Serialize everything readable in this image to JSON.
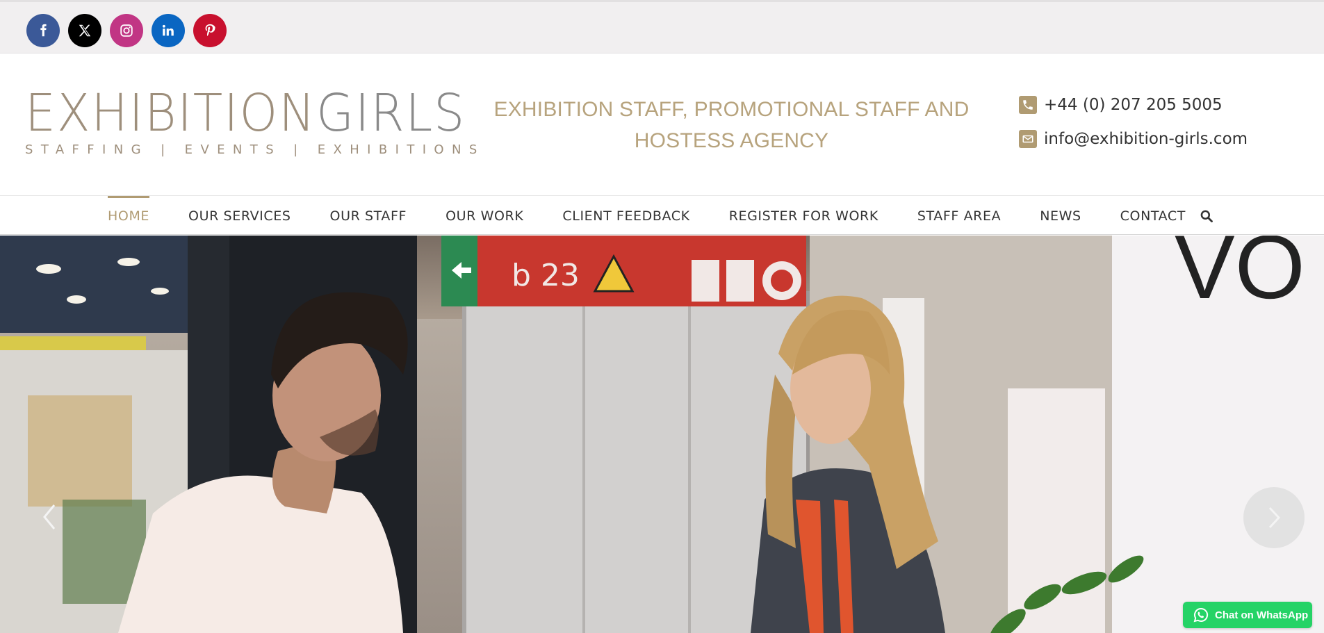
{
  "social": [
    {
      "name": "facebook",
      "icon": "facebook-icon",
      "color": "#3b5998"
    },
    {
      "name": "x",
      "icon": "x-icon",
      "color": "#000000"
    },
    {
      "name": "instagram",
      "icon": "instagram-icon",
      "color": "#c13584"
    },
    {
      "name": "linkedin",
      "icon": "linkedin-icon",
      "color": "#0a66c2"
    },
    {
      "name": "pinterest",
      "icon": "pinterest-icon",
      "color": "#c8102e"
    }
  ],
  "logo": {
    "main_part1": "EXHIBITION",
    "main_part2": "GIRLS",
    "sub": "STAFFING | EVENTS | EXHIBITIONS"
  },
  "tagline": {
    "line1": "EXHIBITION STAFF, PROMOTIONAL STAFF AND",
    "line2": "HOSTESS AGENCY"
  },
  "contact": {
    "phone": "+44 (0) 207 205 5005",
    "email": "info@exhibition-girls.com",
    "accent": "#b09b72"
  },
  "nav": {
    "items": [
      {
        "label": "HOME",
        "active": true
      },
      {
        "label": "OUR SERVICES",
        "active": false
      },
      {
        "label": "OUR STAFF",
        "active": false
      },
      {
        "label": "OUR WORK",
        "active": false
      },
      {
        "label": "CLIENT FEEDBACK",
        "active": false
      },
      {
        "label": "REGISTER FOR WORK",
        "active": false
      },
      {
        "label": "STAFF AREA",
        "active": false
      },
      {
        "label": "NEWS",
        "active": false
      },
      {
        "label": "CONTACT",
        "active": false
      }
    ],
    "search_icon": "search-icon"
  },
  "hero": {
    "sign_text": "b 23",
    "wall_text": "VO"
  },
  "whatsapp": {
    "label": "Chat on WhatsApp",
    "color": "#25d366"
  }
}
